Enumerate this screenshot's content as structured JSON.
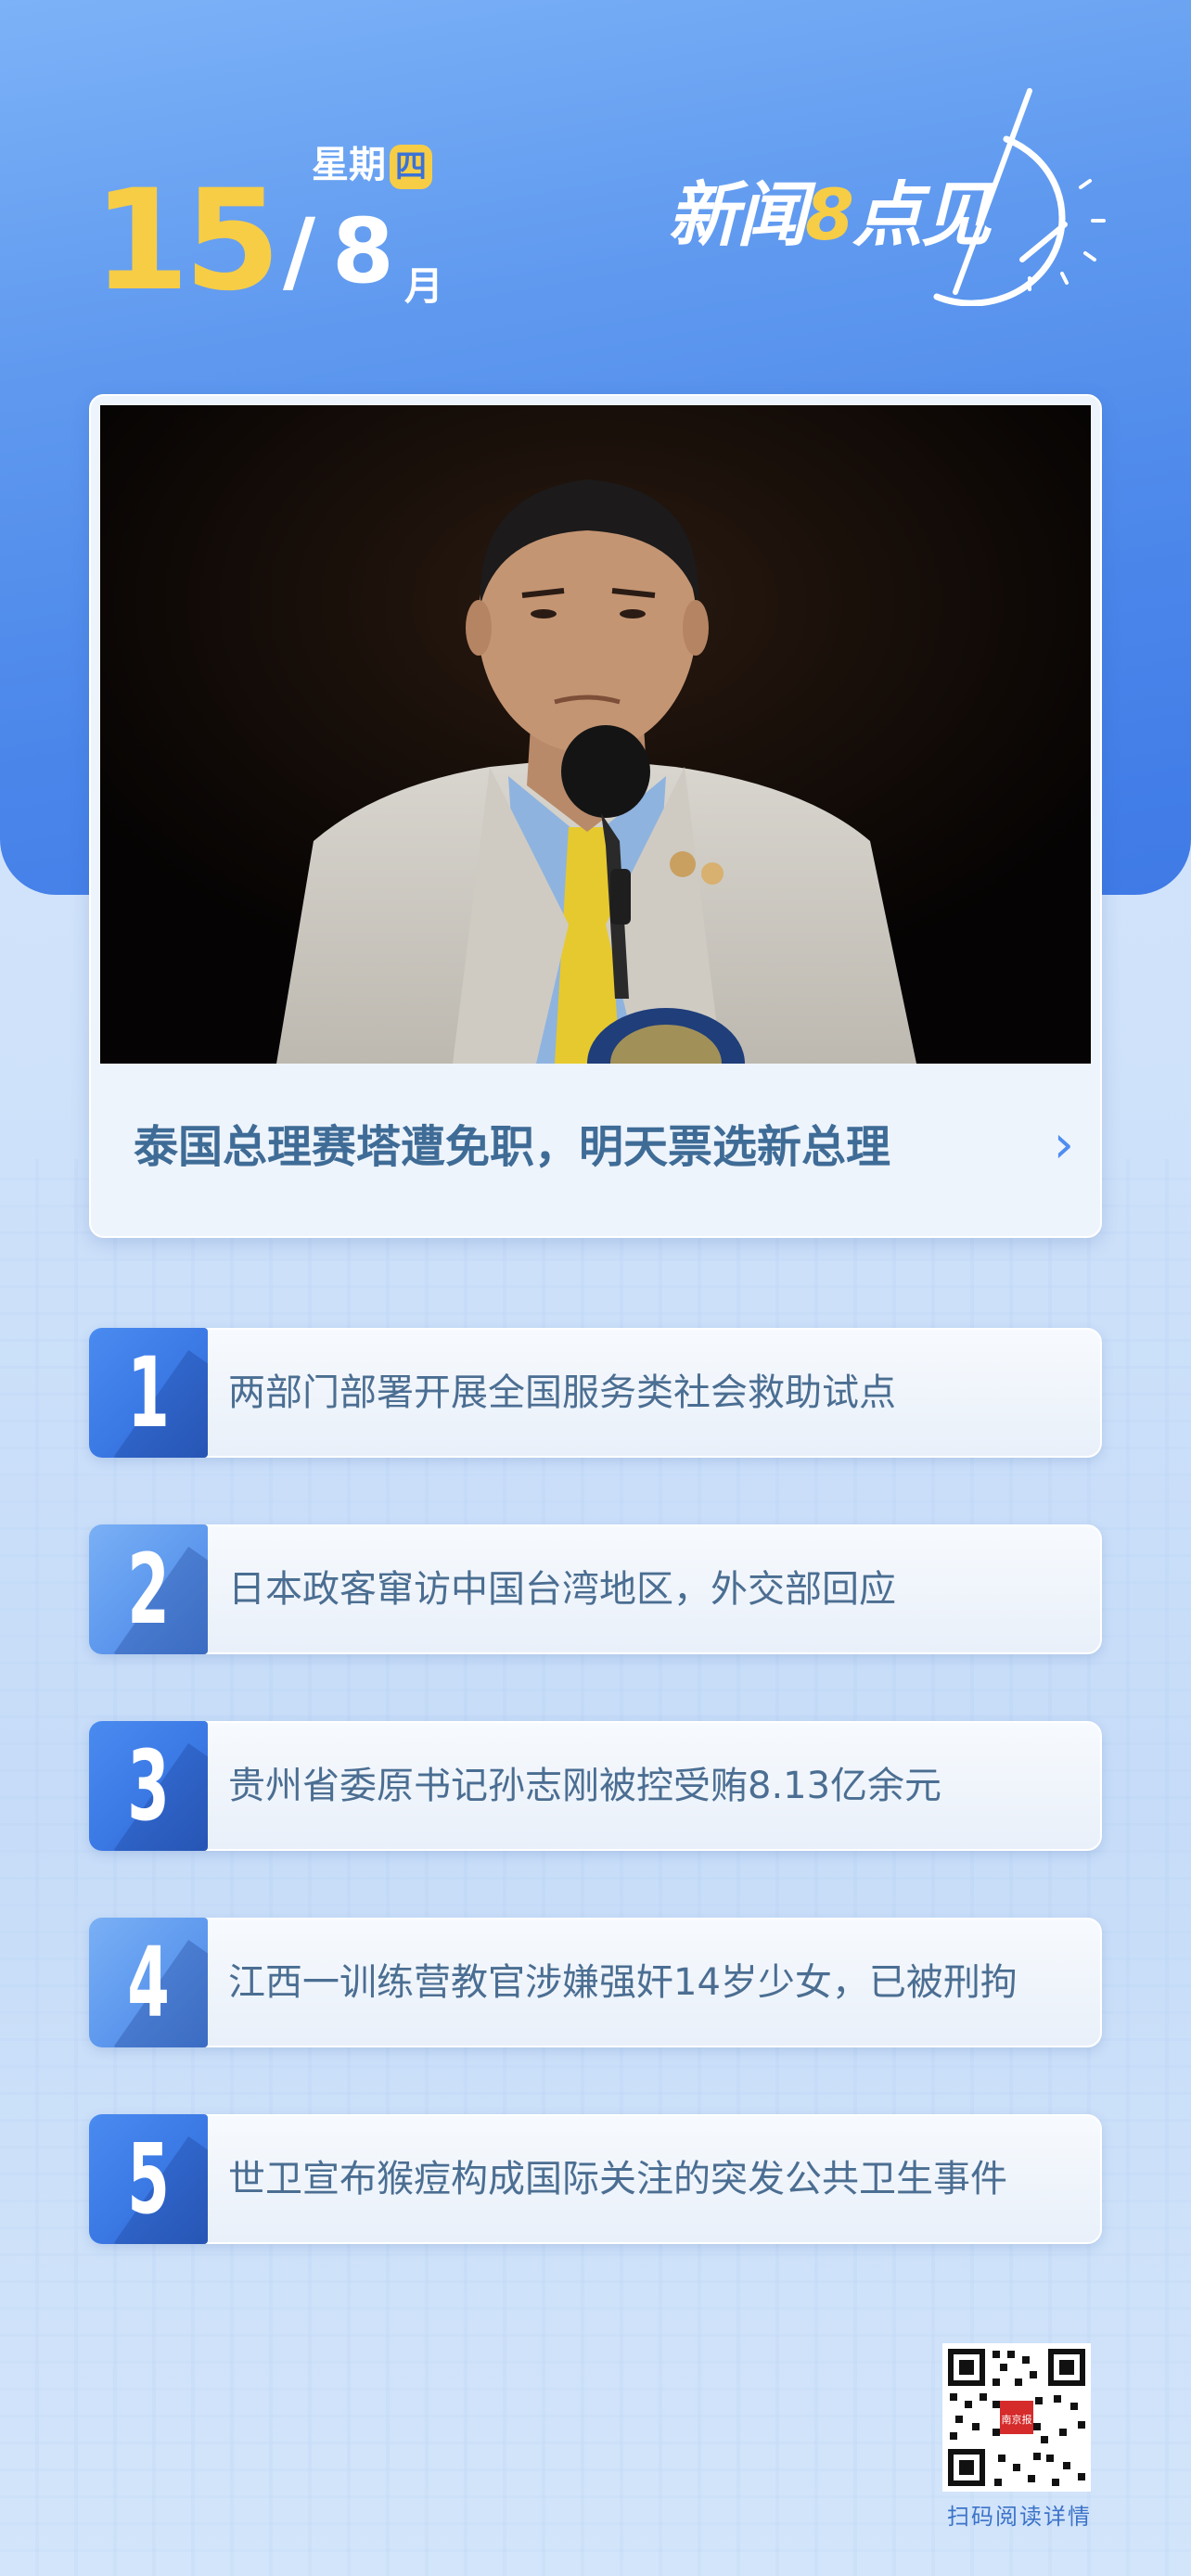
{
  "date": {
    "weekday_prefix": "星期",
    "weekday_char": "四",
    "day": "15",
    "slash": "/",
    "month": "8",
    "month_unit": "月"
  },
  "logo": {
    "part1": "新闻",
    "eight": "8",
    "part2": "点见"
  },
  "feature": {
    "headline": "泰国总理赛塔遭免职，明天票选新总理",
    "chevron": "›"
  },
  "news": [
    {
      "number": "1",
      "text": "两部门部署开展全国服务类社会救助试点"
    },
    {
      "number": "2",
      "text": "日本政客窜访中国台湾地区，外交部回应"
    },
    {
      "number": "3",
      "text": "贵州省委原书记孙志刚被控受贿8.13亿余元"
    },
    {
      "number": "4",
      "text": "江西一训练营教官涉嫌强奸14岁少女，已被刑拘"
    },
    {
      "number": "5",
      "text": "世卫宣布猴痘构成国际关注的突发公共卫生事件"
    }
  ],
  "qr": {
    "label": "扫码阅读详情",
    "center_logo_text": "南京报"
  },
  "colors": {
    "accent_yellow": "#f7cd45",
    "brand_blue": "#3a78e4",
    "headline_text": "#3f6c96"
  }
}
